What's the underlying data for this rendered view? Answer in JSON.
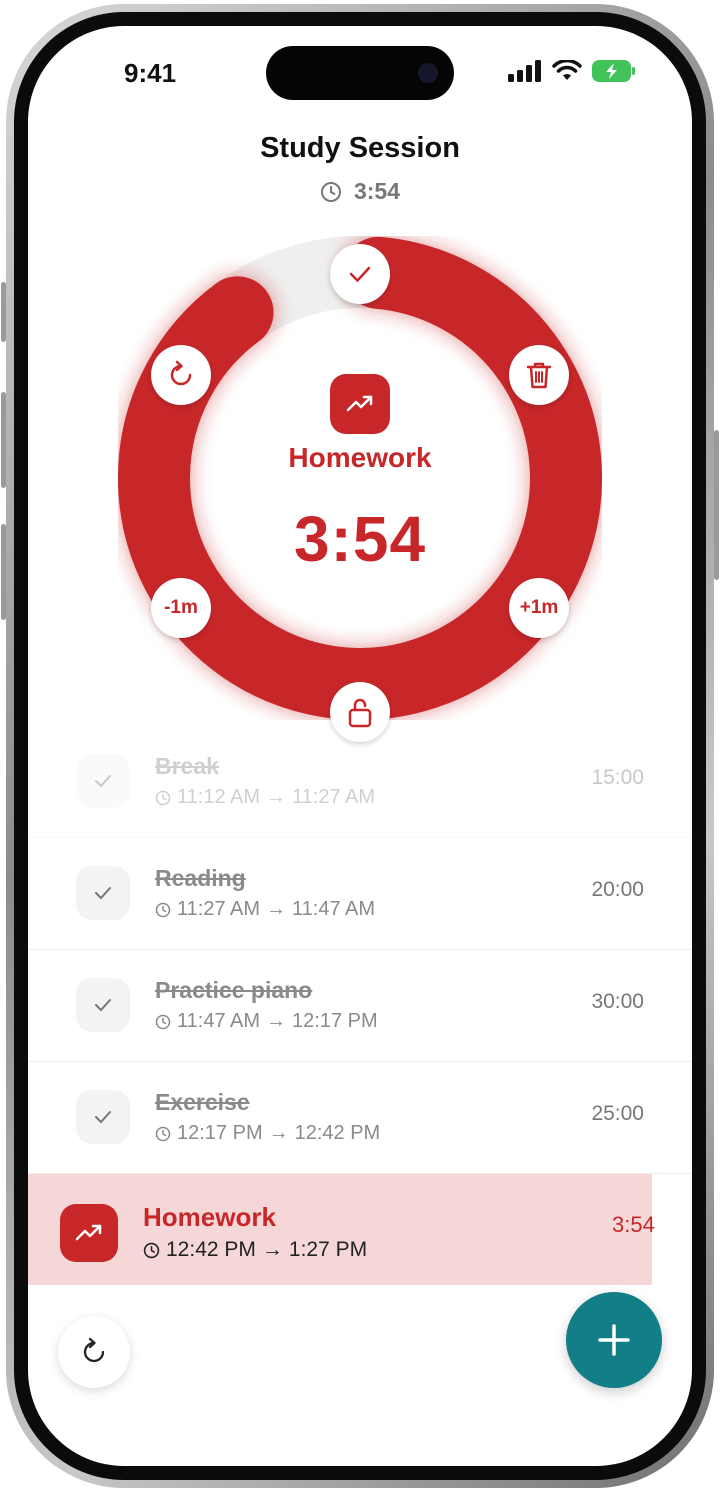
{
  "status_bar": {
    "time": "9:41"
  },
  "header": {
    "title": "Study Session",
    "elapsed": "3:54"
  },
  "timer": {
    "activity": "Homework",
    "remaining": "3:54",
    "progress_fraction": 0.913,
    "minus_label": "-1m",
    "plus_label": "+1m",
    "color": "#c8272a"
  },
  "tasks": [
    {
      "name": "Break",
      "start": "11:12 AM",
      "end": "11:27 AM",
      "duration": "15:00",
      "done": true
    },
    {
      "name": "Reading",
      "start": "11:27 AM",
      "end": "11:47 AM",
      "duration": "20:00",
      "done": true
    },
    {
      "name": "Practice piano",
      "start": "11:47 AM",
      "end": "12:17 PM",
      "duration": "30:00",
      "done": true
    },
    {
      "name": "Exercise",
      "start": "12:17 PM",
      "end": "12:42 PM",
      "duration": "25:00",
      "done": true
    }
  ],
  "active_task": {
    "name": "Homework",
    "start": "12:42 PM",
    "end": "1:27 PM",
    "duration": "3:54"
  },
  "icons": {
    "done": "check-icon",
    "refresh": "refresh-icon",
    "delete": "trash-icon",
    "lock": "unlock-icon",
    "activity": "trending-up-icon",
    "add": "plus-icon",
    "clock": "clock-icon"
  },
  "colors": {
    "accent": "#c8272a",
    "fab": "#117e88",
    "active_row_bg": "#f5d7d8"
  }
}
